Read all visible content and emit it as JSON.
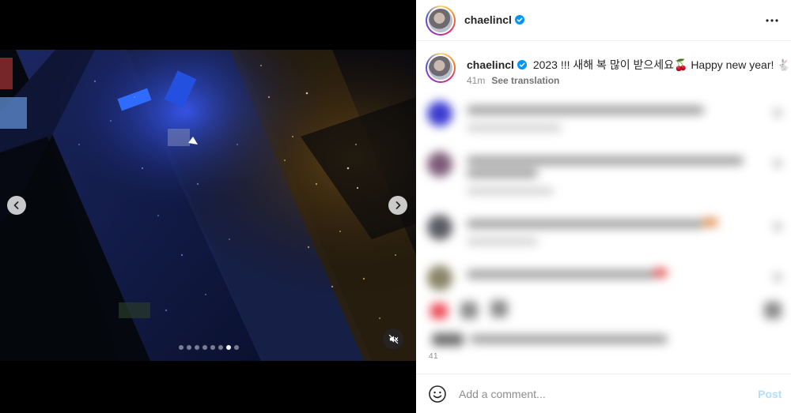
{
  "post": {
    "author": "chaelincl",
    "verified": true,
    "caption_text": "2023 !!! 새해 복 많이 받으세요🍒 Happy new year! 🐇",
    "timestamp": "41m",
    "see_translation": "See translation"
  },
  "media": {
    "carousel_total": 8,
    "carousel_active_index": 6,
    "muted": true,
    "description_icons": [
      "chevron-left-icon",
      "chevron-right-icon",
      "muted-speaker-icon"
    ]
  },
  "comments_area": {
    "blurred": true,
    "partial_timestamp": "41"
  },
  "composer": {
    "placeholder": "Add a comment...",
    "post_label": "Post"
  },
  "colors": {
    "accent_blue": "#0095f6",
    "post_disabled": "#b2dffc",
    "verified_badge": "#0095f6",
    "like_red": "#ed4956"
  }
}
